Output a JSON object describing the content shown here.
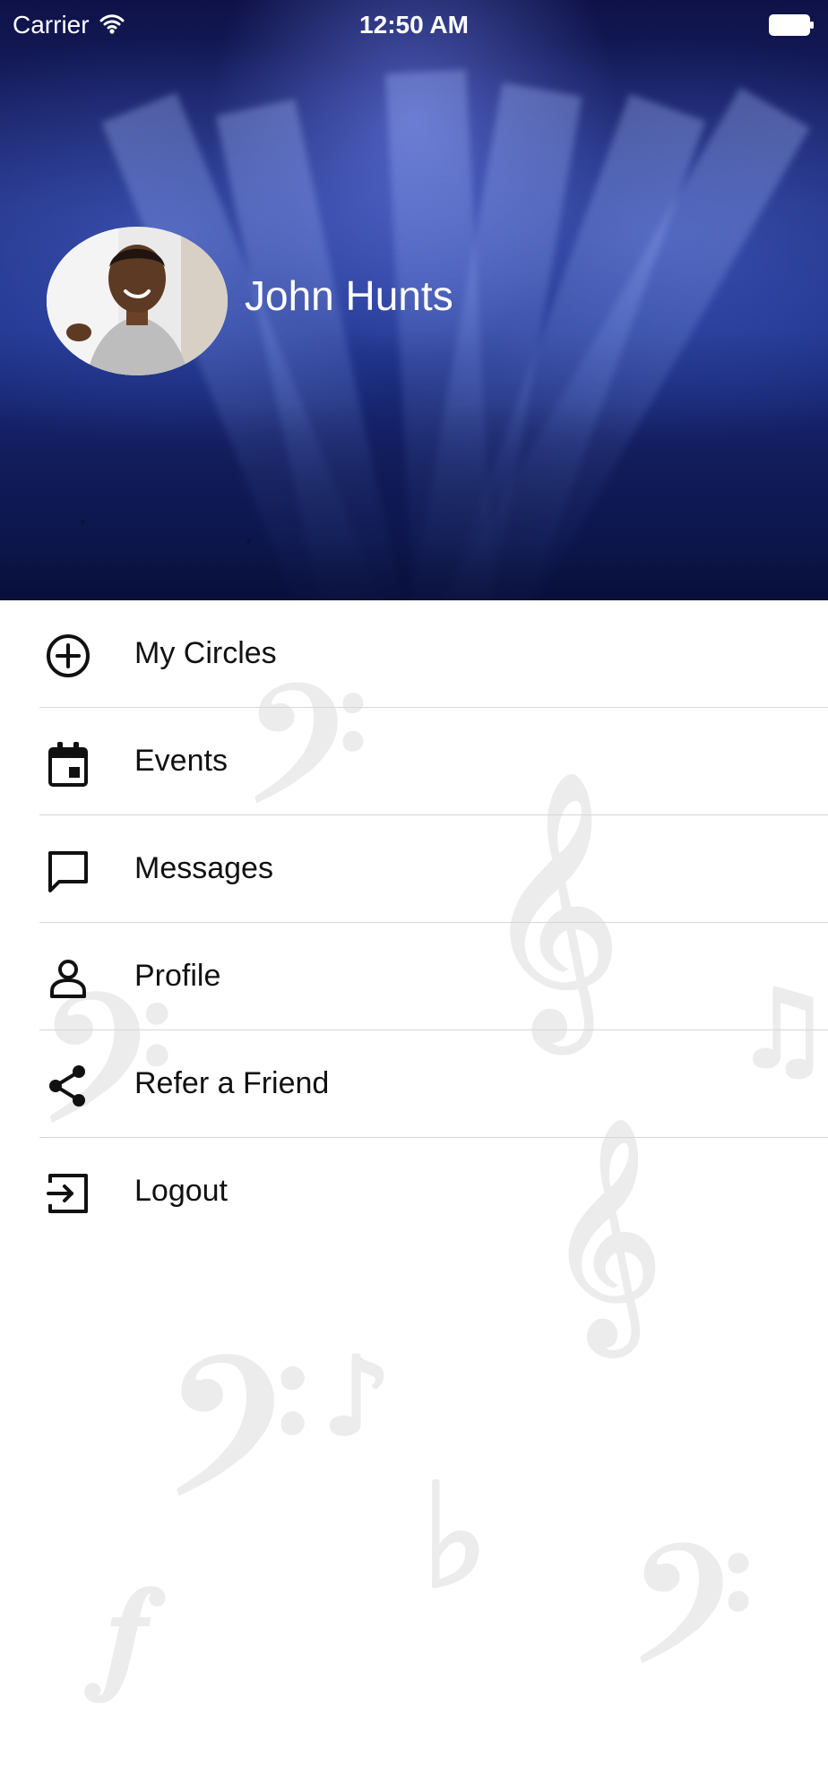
{
  "status_bar": {
    "carrier": "Carrier",
    "time": "12:50 AM",
    "wifi_icon": "wifi-icon",
    "battery_icon": "battery-icon"
  },
  "header": {
    "user_name": "John Hunts"
  },
  "menu": {
    "items": [
      {
        "label": "My Circles",
        "icon": "add-circle-icon"
      },
      {
        "label": "Events",
        "icon": "calendar-icon"
      },
      {
        "label": "Messages",
        "icon": "message-icon"
      },
      {
        "label": "Profile",
        "icon": "person-icon"
      },
      {
        "label": "Refer a Friend",
        "icon": "share-icon"
      },
      {
        "label": "Logout",
        "icon": "logout-icon"
      }
    ]
  },
  "colors": {
    "header_dark": "#0f1247",
    "header_mid": "#1c2a7a",
    "menu_text": "#111111",
    "divider": "#d6d6d6",
    "background": "#ffffff"
  }
}
